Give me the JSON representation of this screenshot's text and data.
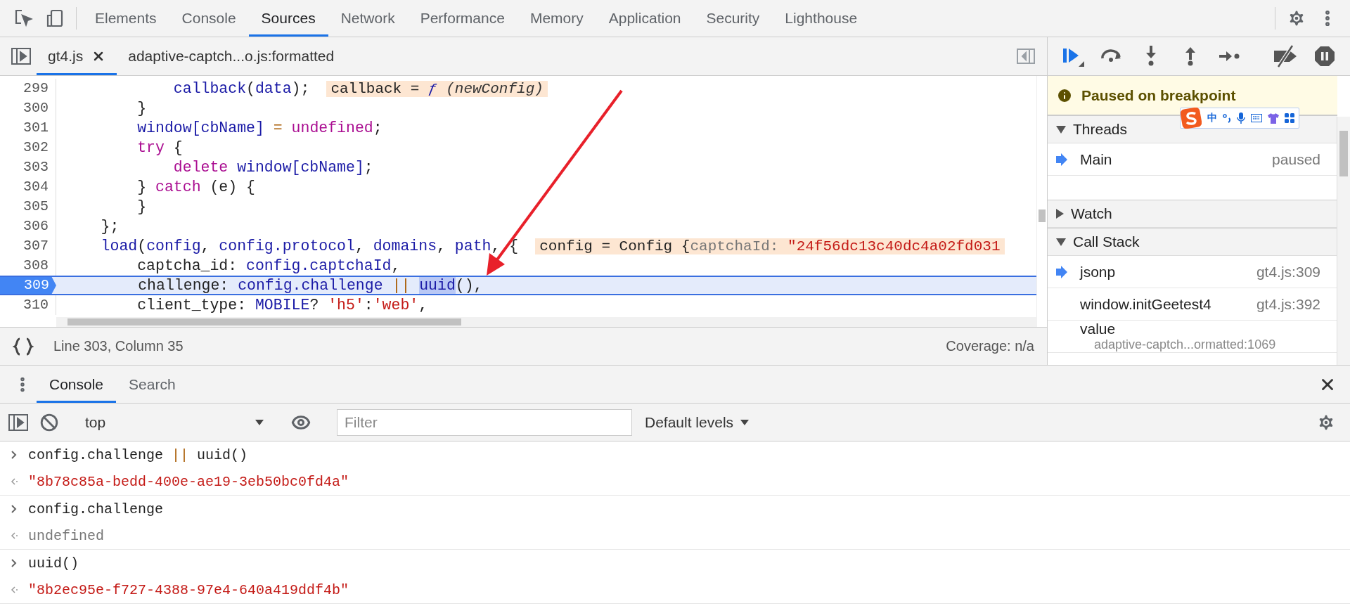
{
  "main_tabs": [
    {
      "label": "Elements",
      "selected": false
    },
    {
      "label": "Console",
      "selected": false
    },
    {
      "label": "Sources",
      "selected": true
    },
    {
      "label": "Network",
      "selected": false
    },
    {
      "label": "Performance",
      "selected": false
    },
    {
      "label": "Memory",
      "selected": false
    },
    {
      "label": "Application",
      "selected": false
    },
    {
      "label": "Security",
      "selected": false
    },
    {
      "label": "Lighthouse",
      "selected": false
    }
  ],
  "file_tabs": [
    {
      "label": "gt4.js",
      "selected": true
    },
    {
      "label": "adaptive-captch...o.js:formatted",
      "selected": false
    }
  ],
  "code_lines": [
    {
      "number": "299",
      "current": false,
      "tokens": [
        {
          "text": "            callback",
          "kind": "var"
        },
        {
          "text": "(",
          "kind": "plain"
        },
        {
          "text": "data",
          "kind": "var"
        },
        {
          "text": ");",
          "kind": "plain"
        }
      ],
      "inline_value": [
        {
          "text": "callback = ",
          "kind": "plain"
        },
        {
          "text": "ƒ",
          "kind": "fn"
        },
        {
          "text": " (newConfig)",
          "kind": "italic"
        }
      ]
    },
    {
      "number": "300",
      "current": false,
      "tokens": [
        {
          "text": "        }",
          "kind": "plain"
        }
      ]
    },
    {
      "number": "301",
      "current": false,
      "tokens": [
        {
          "text": "        window[cbName]",
          "kind": "var"
        },
        {
          "text": " = ",
          "kind": "op"
        },
        {
          "text": "undefined",
          "kind": "kw"
        },
        {
          "text": ";",
          "kind": "plain"
        }
      ]
    },
    {
      "number": "302",
      "current": false,
      "tokens": [
        {
          "text": "        try",
          "kind": "kw"
        },
        {
          "text": " {",
          "kind": "plain"
        }
      ]
    },
    {
      "number": "303",
      "current": false,
      "tokens": [
        {
          "text": "            delete",
          "kind": "kw"
        },
        {
          "text": " window[cbName]",
          "kind": "var"
        },
        {
          "text": ";",
          "kind": "plain"
        }
      ]
    },
    {
      "number": "304",
      "current": false,
      "tokens": [
        {
          "text": "        } ",
          "kind": "plain"
        },
        {
          "text": "catch",
          "kind": "kw"
        },
        {
          "text": " (e) {",
          "kind": "plain"
        }
      ]
    },
    {
      "number": "305",
      "current": false,
      "tokens": [
        {
          "text": "        }",
          "kind": "plain"
        }
      ]
    },
    {
      "number": "306",
      "current": false,
      "tokens": [
        {
          "text": "    };",
          "kind": "plain"
        }
      ]
    },
    {
      "number": "307",
      "current": false,
      "tokens": [
        {
          "text": "    load",
          "kind": "var"
        },
        {
          "text": "(",
          "kind": "plain"
        },
        {
          "text": "config",
          "kind": "var"
        },
        {
          "text": ", ",
          "kind": "plain"
        },
        {
          "text": "config.protocol",
          "kind": "var"
        },
        {
          "text": ", ",
          "kind": "plain"
        },
        {
          "text": "domains",
          "kind": "var"
        },
        {
          "text": ", ",
          "kind": "plain"
        },
        {
          "text": "path",
          "kind": "var"
        },
        {
          "text": ", {",
          "kind": "plain"
        }
      ],
      "inline_value": [
        {
          "text": "config = Config {",
          "kind": "plain"
        },
        {
          "text": "captchaId: ",
          "kind": "prop"
        },
        {
          "text": "\"24f56dc13c40dc4a02fd031",
          "kind": "str"
        }
      ]
    },
    {
      "number": "308",
      "current": false,
      "tokens": [
        {
          "text": "        captcha_id: ",
          "kind": "plain"
        },
        {
          "text": "config.captchaId",
          "kind": "var"
        },
        {
          "text": ",",
          "kind": "plain"
        }
      ]
    },
    {
      "number": "309",
      "current": true,
      "tokens": [
        {
          "text": "        challenge: ",
          "kind": "plain"
        },
        {
          "text": "config.challenge",
          "kind": "var"
        },
        {
          "text": " || ",
          "kind": "op"
        },
        {
          "text": "uuid",
          "kind": "hl"
        },
        {
          "text": "(),",
          "kind": "plain"
        }
      ]
    },
    {
      "number": "310",
      "current": false,
      "tokens": [
        {
          "text": "        client_type: ",
          "kind": "plain"
        },
        {
          "text": "MOBILE",
          "kind": "var"
        },
        {
          "text": "? ",
          "kind": "plain"
        },
        {
          "text": "'h5'",
          "kind": "str"
        },
        {
          "text": ":",
          "kind": "plain"
        },
        {
          "text": "'web'",
          "kind": "str"
        },
        {
          "text": ",",
          "kind": "plain"
        }
      ]
    }
  ],
  "status_bar": {
    "position": "Line 303, Column 35",
    "coverage": "Coverage: n/a"
  },
  "paused_banner": "Paused on breakpoint",
  "ime_toolbar": {
    "mode": "中"
  },
  "sections": [
    {
      "kind": "threads",
      "title": "Threads",
      "expanded": true,
      "items": [
        {
          "name": "Main",
          "detail": "paused",
          "current": true
        }
      ]
    },
    {
      "kind": "watch",
      "title": "Watch",
      "expanded": false
    },
    {
      "kind": "stack",
      "title": "Call Stack",
      "expanded": true,
      "items": [
        {
          "name": "jsonp",
          "detail": "gt4.js:309",
          "current": true
        },
        {
          "name": "window.initGeetest4",
          "detail": "gt4.js:392",
          "current": false
        },
        {
          "name": "value",
          "sub": "adaptive-captch...ormatted:1069",
          "current": false
        }
      ]
    }
  ],
  "drawer_tabs": [
    {
      "label": "Console",
      "selected": true
    },
    {
      "label": "Search",
      "selected": false
    }
  ],
  "console_toolbar": {
    "context": "top",
    "filter_placeholder": "Filter",
    "levels": "Default levels"
  },
  "console_messages": [
    {
      "kind": "input",
      "tokens": [
        {
          "text": "config.challenge ",
          "kind": "plain"
        },
        {
          "text": "||",
          "kind": "op"
        },
        {
          "text": " uuid()",
          "kind": "plain"
        }
      ]
    },
    {
      "kind": "result",
      "tokens": [
        {
          "text": "\"8b78c85a-bedd-400e-ae19-3eb50bc0fd4a\"",
          "kind": "str"
        }
      ]
    },
    {
      "kind": "input",
      "tokens": [
        {
          "text": "config.challenge",
          "kind": "plain"
        }
      ]
    },
    {
      "kind": "result",
      "tokens": [
        {
          "text": "undefined",
          "kind": "undef"
        }
      ]
    },
    {
      "kind": "input",
      "tokens": [
        {
          "text": "uuid()",
          "kind": "plain"
        }
      ]
    },
    {
      "kind": "result",
      "tokens": [
        {
          "text": "\"8b2ec95e-f727-4388-97e4-640a419ddf4b\"",
          "kind": "str"
        }
      ]
    }
  ]
}
